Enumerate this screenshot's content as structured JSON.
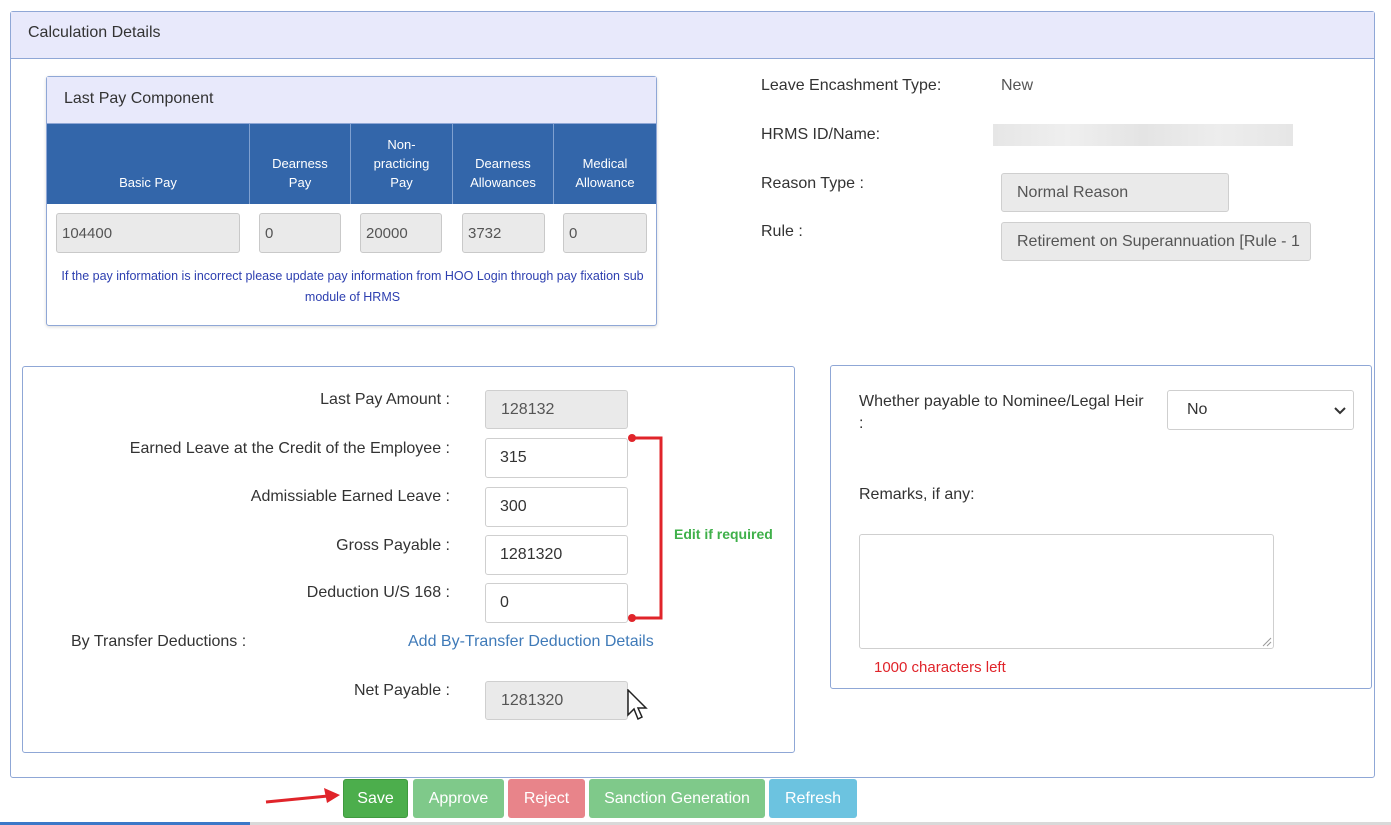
{
  "panel": {
    "title": "Calculation Details"
  },
  "last_pay": {
    "title": "Last Pay Component",
    "headers": [
      "Basic Pay",
      "Dearness Pay",
      "Non-practicing Pay",
      "Dearness Allowances",
      "Medical Allowance"
    ],
    "values": [
      "104400",
      "0",
      "20000",
      "3732",
      "0"
    ],
    "note": "If the pay information is incorrect please update pay information from HOO Login through pay fixation sub module of HRMS"
  },
  "info": {
    "leave_type_label": "Leave Encashment Type:",
    "leave_type_value": "New",
    "hrms_label": "HRMS ID/Name:",
    "reason_label": "Reason Type :",
    "reason_value": "Normal Reason",
    "rule_label": "Rule :",
    "rule_value": "Retirement on Superannuation [Rule - 1"
  },
  "calc": {
    "last_pay_label": "Last Pay Amount :",
    "last_pay_value": "128132",
    "earned_label": "Earned Leave at the Credit of the Employee :",
    "earned_value": "315",
    "admissible_label": "Admissiable Earned Leave :",
    "admissible_value": "300",
    "gross_label": "Gross Payable :",
    "gross_value": "1281320",
    "deduction_label": "Deduction U/S 168 :",
    "deduction_value": "0",
    "transfer_label": "By Transfer Deductions :",
    "transfer_link": "Add By-Transfer Deduction Details",
    "net_label": "Net Payable :",
    "net_value": "1281320"
  },
  "annotation": {
    "edit_note": "Edit if required"
  },
  "nominee": {
    "label": "Whether payable to Nominee/Legal Heir :",
    "selected": "No",
    "remarks_label": "Remarks, if any:",
    "chars_left": "1000 characters left"
  },
  "buttons": {
    "save": "Save",
    "approve": "Approve",
    "reject": "Reject",
    "sanction": "Sanction Generation",
    "refresh": "Refresh"
  },
  "colors": {
    "header_blue": "#3366aa",
    "save_green": "#4cae4c",
    "approve_green": "#7fc98a",
    "reject_red": "#e8848a",
    "refresh_blue": "#6cc3e0",
    "annotation_red": "#e0242a",
    "edit_green": "#3fb04a"
  }
}
